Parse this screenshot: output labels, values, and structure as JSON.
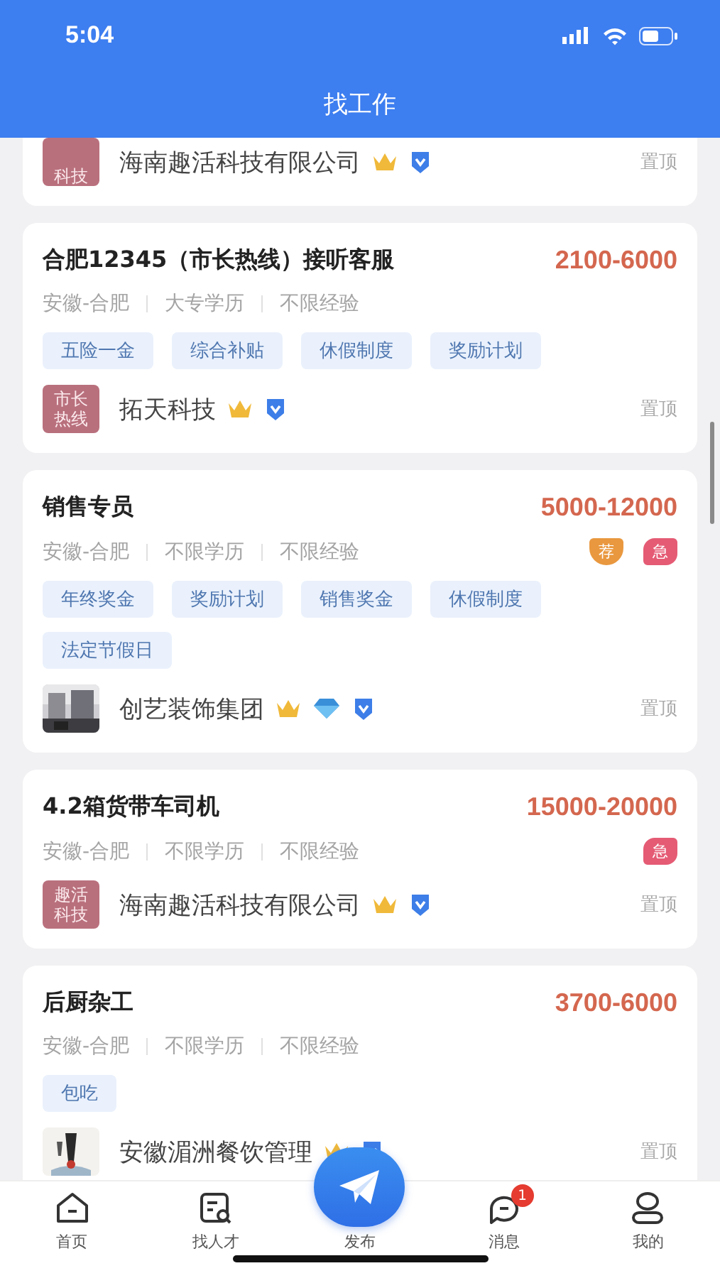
{
  "status_bar": {
    "time": "5:04"
  },
  "header": {
    "title": "找工作"
  },
  "jobs": [
    {
      "company": {
        "name": "海南趣活科技有限公司",
        "logo": {
          "kind": "text",
          "lines": [
            "科技"
          ]
        },
        "crown": true,
        "diamond": false,
        "verified": true
      },
      "pin": "置顶"
    },
    {
      "title": "合肥12345（市长热线）接听客服",
      "salary": "2100-6000",
      "meta": [
        "安徽-合肥",
        "大专学历",
        "不限经验"
      ],
      "tags": [
        "五险一金",
        "综合补贴",
        "休假制度",
        "奖励计划"
      ],
      "company": {
        "name": "拓天科技",
        "logo": {
          "kind": "text",
          "lines": [
            "市长",
            "热线"
          ]
        },
        "crown": true,
        "diamond": false,
        "verified": true
      },
      "pin": "置顶"
    },
    {
      "title": "销售专员",
      "salary": "5000-12000",
      "meta": [
        "安徽-合肥",
        "不限学历",
        "不限经验"
      ],
      "badges": [
        {
          "kind": "recommend",
          "text": "荐"
        },
        {
          "kind": "urgent",
          "text": "急"
        }
      ],
      "tags": [
        "年终奖金",
        "奖励计划",
        "销售奖金",
        "休假制度",
        "法定节假日"
      ],
      "company": {
        "name": "创艺装饰集团",
        "crown": true,
        "diamond": true,
        "verified": true
      },
      "pin": "置顶"
    },
    {
      "title": "4.2箱货带车司机",
      "salary": "15000-20000",
      "meta": [
        "安徽-合肥",
        "不限学历",
        "不限经验"
      ],
      "badges": [
        {
          "kind": "urgent",
          "text": "急"
        }
      ],
      "company": {
        "name": "海南趣活科技有限公司",
        "logo": {
          "kind": "text",
          "lines": [
            "趣活",
            "科技"
          ]
        },
        "crown": true,
        "diamond": false,
        "verified": true
      },
      "pin": "置顶"
    },
    {
      "title": "后厨杂工",
      "salary": "3700-6000",
      "meta": [
        "安徽-合肥",
        "不限学历",
        "不限经验"
      ],
      "tags": [
        "包吃"
      ],
      "company": {
        "name": "安徽湄洲餐饮管理",
        "crown": true,
        "diamond": false,
        "verified": true
      },
      "pin": "置顶"
    }
  ],
  "tab_bar": [
    {
      "kind": "home",
      "label": "首页"
    },
    {
      "kind": "talent",
      "label": "找人才"
    },
    {
      "kind": "publish",
      "label": "发布"
    },
    {
      "kind": "messages",
      "label": "消息",
      "badge": "1"
    },
    {
      "kind": "profile",
      "label": "我的"
    }
  ]
}
